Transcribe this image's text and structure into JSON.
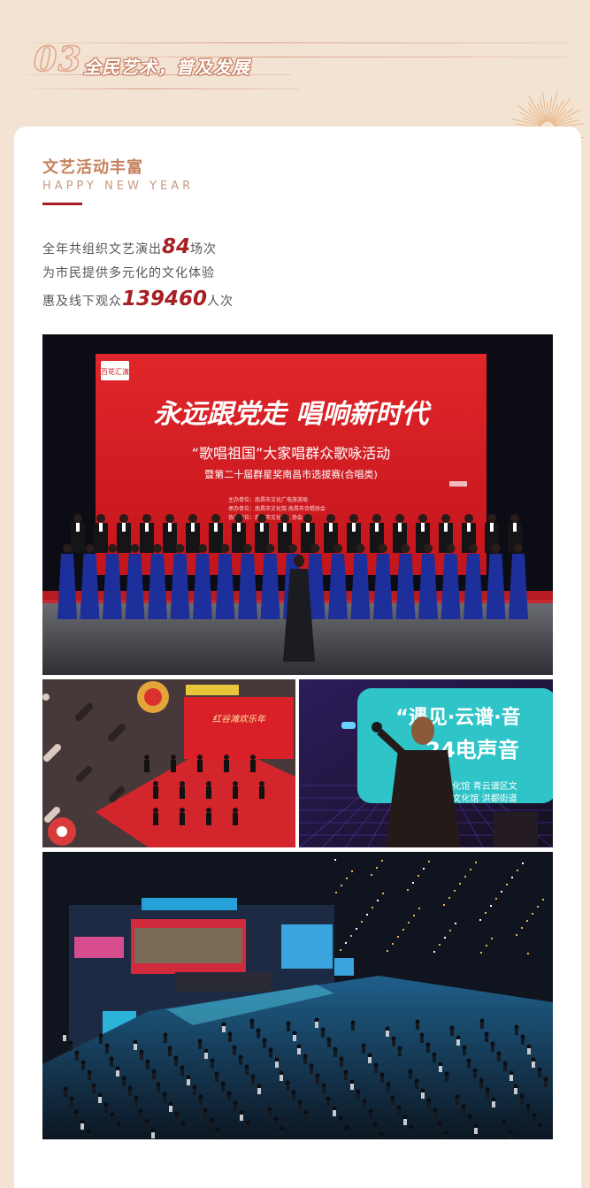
{
  "header": {
    "number": "03",
    "title": "全民艺术，普及发展"
  },
  "section": {
    "title": "文艺活动丰富",
    "subtitle": "HAPPY NEW YEAR"
  },
  "paragraph": {
    "line1_prefix": "全年共组织文艺演出",
    "performances": "84",
    "line1_suffix": "场次",
    "line2": "为市民提供多元化的文化体验",
    "line3_prefix": "惠及线下观众",
    "audience": "139460",
    "line3_suffix": "人次"
  },
  "photos": {
    "choir_banner": {
      "headline": "永远跟党走 唱响新时代",
      "subline1": "“歌唱祖国”大家唱群众歌咏活动",
      "subline2": "暨第二十届群星奖南昌市选拔赛(合唱类)",
      "org1": "主办单位：南昌市文化广电旅游局",
      "org2": "承办单位：南昌市文化馆 南昌市合唱协会",
      "org3": "协办单位：南昌市文化馆…协会",
      "logo": "百花汇演"
    },
    "dance_banner": "红谷滩欢乐年",
    "stage_banner": {
      "line1": "“遇见·云谱·音",
      "line2": "24电声音",
      "org1": "市文化馆  青云谱区文",
      "org2": "谱区文化馆  洪都街道"
    }
  },
  "colors": {
    "background": "#f3e3d3",
    "accent_red": "#a81f24",
    "title_brown": "#c6815c"
  }
}
